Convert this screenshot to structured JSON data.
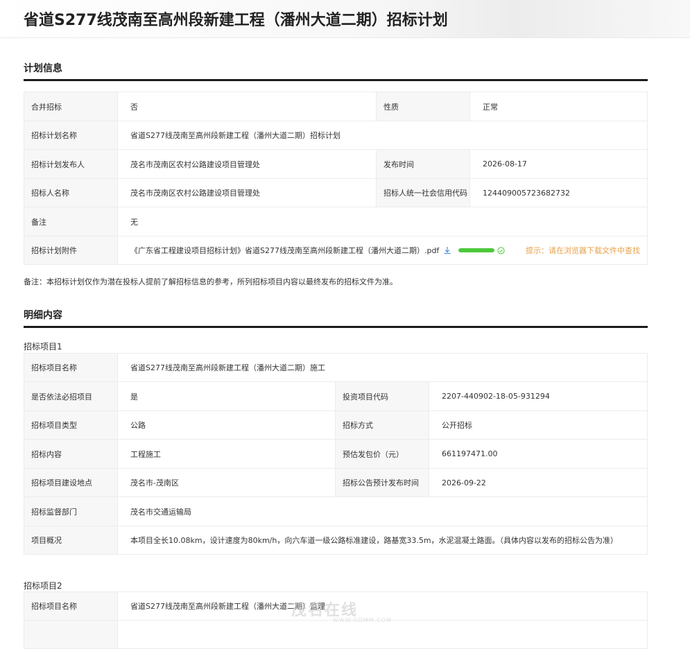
{
  "page": {
    "title": "省道S277线茂南至高州段新建工程（潘州大道二期）招标计划"
  },
  "plan_section": {
    "heading": "计划信息",
    "merged_label": "合并招标",
    "merged_value": "否",
    "nature_label": "性质",
    "nature_value": "正常",
    "plan_name_label": "招标计划名称",
    "plan_name_value": "省道S277线茂南至高州段新建工程（潘州大道二期）招标计划",
    "publisher_label": "招标计划发布人",
    "publisher_value": "茂名市茂南区农村公路建设项目管理处",
    "publish_time_label": "发布时间",
    "publish_time_value": "2026-08-17",
    "tenderer_label": "招标人名称",
    "tenderer_value": "茂名市茂南区农村公路建设项目管理处",
    "credit_code_label": "招标人统一社会信用代码",
    "credit_code_value": "124409005723682732",
    "remark_label": "备注",
    "remark_value": "无",
    "attachment_label": "招标计划附件",
    "attachment_file": "《广东省工程建设项目招标计划》省道S277线茂南至高州段新建工程（潘州大道二期）.pdf",
    "download_progress": 1.0,
    "attachment_tip": "提示：请在浏览器下载文件中查找"
  },
  "disclaimer": "备注：本招标计划仅作为潜在投标人提前了解招标信息的参考，所列招标项目内容以最终发布的招标文件为准。",
  "detail_section": {
    "heading": "明细内容",
    "item1": {
      "caption": "招标项目1",
      "name_label": "招标项目名称",
      "name_value": "省道S277线茂南至高州段新建工程（潘州大道二期）施工",
      "mandatory_label": "是否依法必招项目",
      "mandatory_value": "是",
      "invest_code_label": "投资项目代码",
      "invest_code_value": "2207-440902-18-05-931294",
      "type_label": "招标项目类型",
      "type_value": "公路",
      "method_label": "招标方式",
      "method_value": "公开招标",
      "content_label": "招标内容",
      "content_value": "工程施工",
      "price_label": "预估发包价（元）",
      "price_value": "661197471.00",
      "location_label": "招标项目建设地点",
      "location_value": "茂名市-茂南区",
      "notice_time_label": "招标公告预计发布时间",
      "notice_time_value": "2026-09-22",
      "supervisor_label": "招标监督部门",
      "supervisor_value": "茂名市交通运输局",
      "overview_label": "项目概况",
      "overview_value": "本项目全长10.08km，设计速度为80km/h，向六车道一级公路标准建设，路基宽33.5m，水泥混凝土路面。（具体内容以发布的招标公告为准）"
    },
    "item2": {
      "caption": "招标项目2",
      "name_label": "招标项目名称",
      "name_value": "省道S277线茂南至高州段新建工程（潘州大道二期）监理"
    }
  },
  "watermark": {
    "brand": "茂名在线",
    "url": "WWW.GDMM.COM"
  },
  "colors": {
    "tip": "#e8a14a",
    "progress": "#4cc93c",
    "label_bg": "#f7f7f7"
  }
}
